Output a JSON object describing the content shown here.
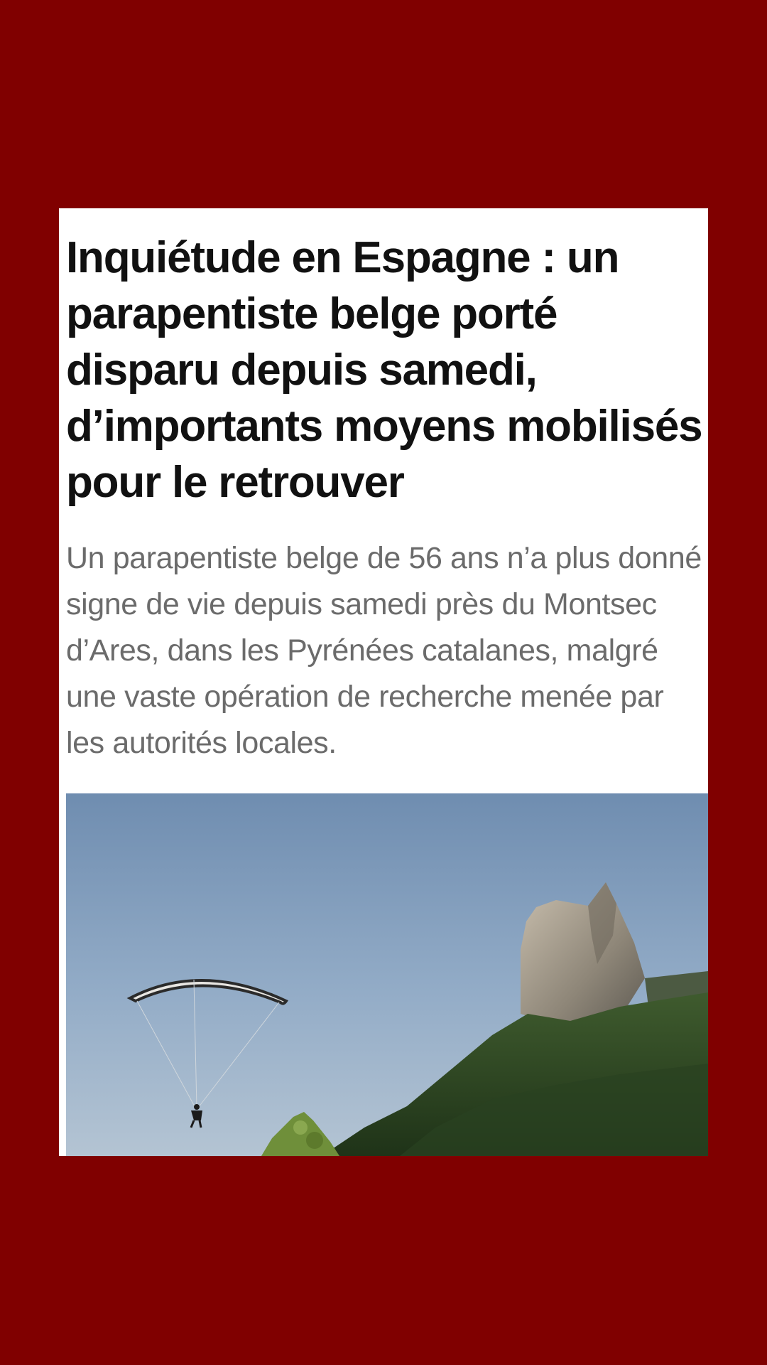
{
  "article": {
    "headline": "Inquiétude en Espagne : un parapentiste belge porté disparu depuis samedi, d’importants moyens mobilisés pour le retrouver",
    "lede": "Un parapentiste belge de 56 ans n’a plus donné signe de vie depuis samedi près du Montsec d’Ares, dans les Pyrénées catalanes, malgré une vaste opération de recherche menée par les autorités locales.",
    "image": {
      "icon": "photo-paraglider-mountain"
    }
  },
  "colors": {
    "background": "#800000",
    "card": "#ffffff",
    "headline": "#111111",
    "lede": "#6b6b6b"
  }
}
